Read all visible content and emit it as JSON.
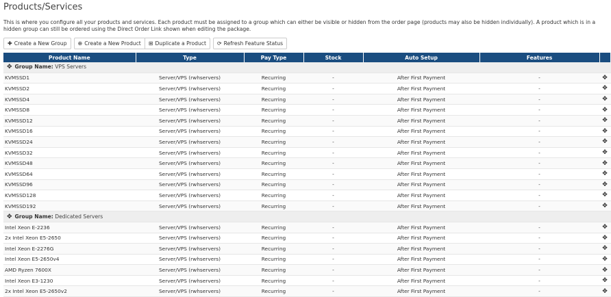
{
  "page": {
    "title": "Products/Services",
    "description": "This is where you configure all your products and services. Each product must be assigned to a group which can either be visible or hidden from the order page (products may also be hidden individually). A product which is in a hidden group can still be ordered using the Direct Order Link shown when editing the package."
  },
  "toolbar": {
    "create_group": "Create a New Group",
    "create_product": "Create a New Product",
    "duplicate_product": "Duplicate a Product",
    "refresh_features": "Refresh Feature Status"
  },
  "table": {
    "headers": [
      "Product Name",
      "Type",
      "Pay Type",
      "Stock",
      "Auto Setup",
      "Features"
    ],
    "group_label": "Group Name:",
    "groups": [
      {
        "name": "VPS Servers",
        "products": [
          {
            "name": "KVMSSD1",
            "type": "Server/VPS (rwhservers)",
            "pay": "Recurring",
            "stock": "-",
            "auto": "After First Payment",
            "features": "-"
          },
          {
            "name": "KVMSSD2",
            "type": "Server/VPS (rwhservers)",
            "pay": "Recurring",
            "stock": "-",
            "auto": "After First Payment",
            "features": "-"
          },
          {
            "name": "KVMSSD4",
            "type": "Server/VPS (rwhservers)",
            "pay": "Recurring",
            "stock": "-",
            "auto": "After First Payment",
            "features": "-"
          },
          {
            "name": "KVMSSD8",
            "type": "Server/VPS (rwhservers)",
            "pay": "Recurring",
            "stock": "-",
            "auto": "After First Payment",
            "features": "-"
          },
          {
            "name": "KVMSSD12",
            "type": "Server/VPS (rwhservers)",
            "pay": "Recurring",
            "stock": "-",
            "auto": "After First Payment",
            "features": "-"
          },
          {
            "name": "KVMSSD16",
            "type": "Server/VPS (rwhservers)",
            "pay": "Recurring",
            "stock": "-",
            "auto": "After First Payment",
            "features": "-"
          },
          {
            "name": "KVMSSD24",
            "type": "Server/VPS (rwhservers)",
            "pay": "Recurring",
            "stock": "-",
            "auto": "After First Payment",
            "features": "-"
          },
          {
            "name": "KVMSSD32",
            "type": "Server/VPS (rwhservers)",
            "pay": "Recurring",
            "stock": "-",
            "auto": "After First Payment",
            "features": "-"
          },
          {
            "name": "KVMSSD48",
            "type": "Server/VPS (rwhservers)",
            "pay": "Recurring",
            "stock": "-",
            "auto": "After First Payment",
            "features": "-"
          },
          {
            "name": "KVMSSD64",
            "type": "Server/VPS (rwhservers)",
            "pay": "Recurring",
            "stock": "-",
            "auto": "After First Payment",
            "features": "-"
          },
          {
            "name": "KVMSSD96",
            "type": "Server/VPS (rwhservers)",
            "pay": "Recurring",
            "stock": "-",
            "auto": "After First Payment",
            "features": "-"
          },
          {
            "name": "KVMSSD128",
            "type": "Server/VPS (rwhservers)",
            "pay": "Recurring",
            "stock": "-",
            "auto": "After First Payment",
            "features": "-"
          },
          {
            "name": "KVMSSD192",
            "type": "Server/VPS (rwhservers)",
            "pay": "Recurring",
            "stock": "-",
            "auto": "After First Payment",
            "features": "-"
          }
        ]
      },
      {
        "name": "Dedicated Servers",
        "products": [
          {
            "name": "Intel Xeon E-2236",
            "type": "Server/VPS (rwhservers)",
            "pay": "Recurring",
            "stock": "-",
            "auto": "After First Payment",
            "features": "-"
          },
          {
            "name": "2x Intel Xeon E5-2650",
            "type": "Server/VPS (rwhservers)",
            "pay": "Recurring",
            "stock": "-",
            "auto": "After First Payment",
            "features": "-"
          },
          {
            "name": "Intel Xeon E-2276G",
            "type": "Server/VPS (rwhservers)",
            "pay": "Recurring",
            "stock": "-",
            "auto": "After First Payment",
            "features": "-"
          },
          {
            "name": "Intel Xeon E5-2650v4",
            "type": "Server/VPS (rwhservers)",
            "pay": "Recurring",
            "stock": "-",
            "auto": "After First Payment",
            "features": "-"
          },
          {
            "name": "AMD Ryzen 7600X",
            "type": "Server/VPS (rwhservers)",
            "pay": "Recurring",
            "stock": "-",
            "auto": "After First Payment",
            "features": "-"
          },
          {
            "name": "Intel Xeon E3-1230",
            "type": "Server/VPS (rwhservers)",
            "pay": "Recurring",
            "stock": "-",
            "auto": "After First Payment",
            "features": "-"
          },
          {
            "name": "2x Intel Xeon E5-2650v2",
            "type": "Server/VPS (rwhservers)",
            "pay": "Recurring",
            "stock": "-",
            "auto": "After First Payment",
            "features": "-"
          }
        ]
      }
    ]
  },
  "icons": {
    "move": "move-icon",
    "edit": "edit-icon",
    "delete": "delete-icon",
    "plus": "plus-icon",
    "plus_circle": "plus-circle-icon",
    "plus_square": "plus-square-icon",
    "refresh": "refresh-icon"
  },
  "colors": {
    "header_bg": "#1a4d80",
    "group_row_bg": "#eeeeee",
    "delete_icon": "#e14b4b",
    "edit_icon": "#f1d46a"
  }
}
